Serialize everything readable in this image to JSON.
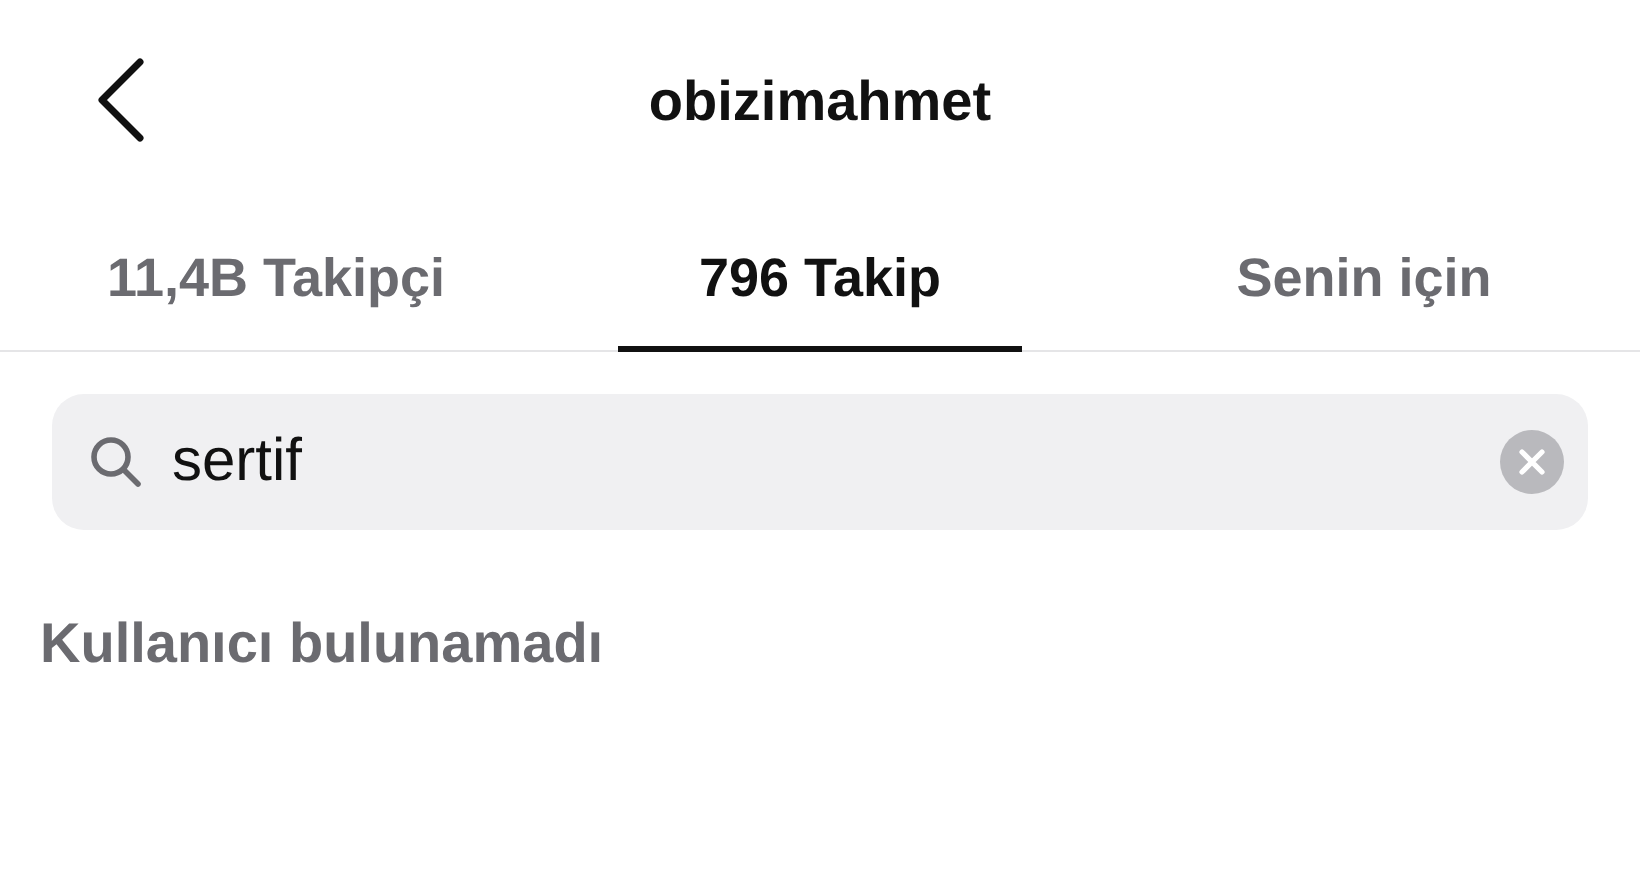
{
  "header": {
    "title": "obizimahmet"
  },
  "tabs": [
    {
      "label": "11,4B Takipçi",
      "selected": false
    },
    {
      "label": "796 Takip",
      "selected": true
    },
    {
      "label": "Senin için",
      "selected": false
    }
  ],
  "search": {
    "value": "sertif"
  },
  "message": "Kullanıcı bulunamadı"
}
